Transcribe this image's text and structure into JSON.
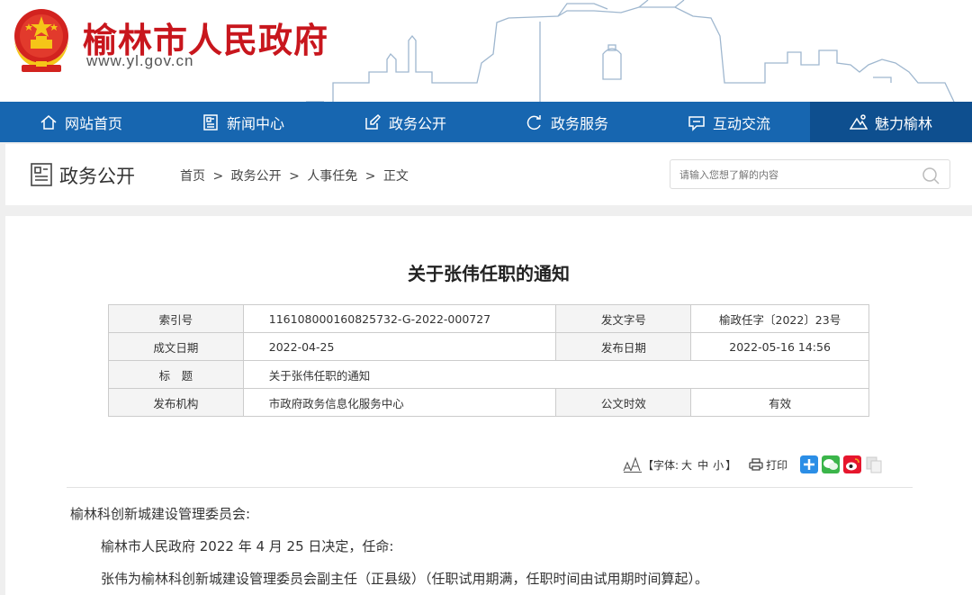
{
  "header": {
    "site_title": "榆林市人民政府",
    "site_url": "www.yl.gov.cn",
    "emblem_icon": "national-emblem-icon"
  },
  "nav": {
    "items": [
      {
        "label": "网站首页",
        "icon": "home-icon"
      },
      {
        "label": "新闻中心",
        "icon": "newspaper-icon"
      },
      {
        "label": "政务公开",
        "icon": "edit-icon"
      },
      {
        "label": "政务服务",
        "icon": "service-icon"
      },
      {
        "label": "互动交流",
        "icon": "chat-icon"
      },
      {
        "label": "魅力榆林",
        "icon": "mountain-icon"
      }
    ],
    "active_index": 5
  },
  "section": {
    "title": "政务公开",
    "breadcrumb": [
      "首页",
      "政务公开",
      "人事任免",
      "正文"
    ],
    "separator": ">"
  },
  "search": {
    "placeholder": "请输入您想了解的内容"
  },
  "document": {
    "title": "关于张伟任职的通知",
    "meta": {
      "index_label": "索引号",
      "index_value": "116108000160825732-G-2022-000727",
      "docno_label": "发文字号",
      "docno_value": "榆政任字〔2022〕23号",
      "created_label": "成文日期",
      "created_value": "2022-04-25",
      "published_label": "发布日期",
      "published_value": "2022-05-16 14:56",
      "subject_label": "标　题",
      "subject_value": "关于张伟任职的通知",
      "issuer_label": "发布机构",
      "issuer_value": "市政府政务信息化服务中心",
      "validity_label": "公文时效",
      "validity_value": "有效"
    },
    "tools": {
      "font_prefix": "【字体:",
      "font_large": "大",
      "font_medium": "中",
      "font_small": "小",
      "font_suffix": "】",
      "print_label": "打印"
    },
    "body": {
      "salutation": "榆林科创新城建设管理委员会:",
      "para1": "榆林市人民政府 2022 年 4 月 25 日决定，任命:",
      "para2": "张伟为榆林科创新城建设管理委员会副主任（正县级）（任职试用期满，任职时间由试用期时间算起）。"
    }
  },
  "colors": {
    "brand_red": "#c8161d",
    "nav_blue": "#1766b0",
    "nav_active": "#0e4f8f"
  }
}
